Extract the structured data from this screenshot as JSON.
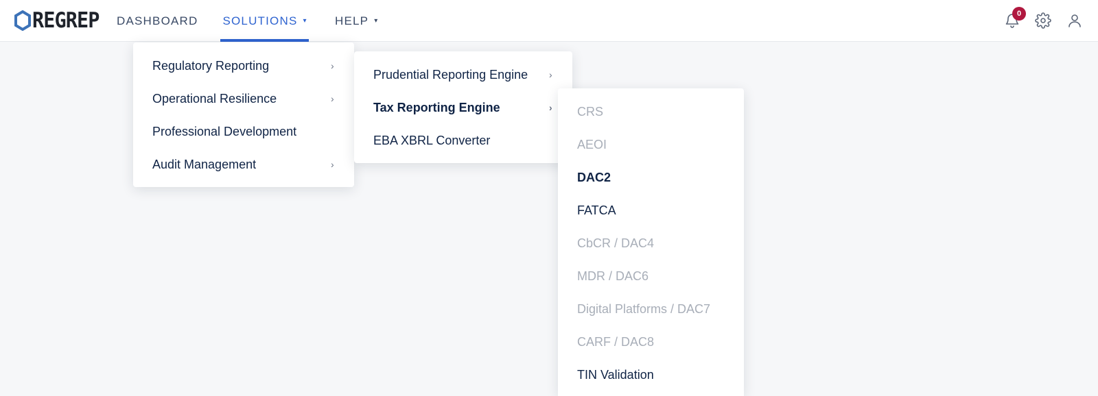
{
  "app": {
    "logo_text": "REGREP",
    "brand_color": "#3d73b8",
    "accent_color": "#2f64d0",
    "badge_color": "#b0183f"
  },
  "nav": {
    "dashboard": "DASHBOARD",
    "solutions": "SOLUTIONS",
    "help": "HELP",
    "caret": "▾"
  },
  "header_icons": {
    "notifications_icon": "bell-icon",
    "notifications_count": "0",
    "settings_icon": "gear-icon",
    "account_icon": "user-icon"
  },
  "solutions_menu": {
    "items": [
      {
        "label": "Regulatory Reporting",
        "has_submenu": true
      },
      {
        "label": "Operational Resilience",
        "has_submenu": true
      },
      {
        "label": "Professional Development",
        "has_submenu": false
      },
      {
        "label": "Audit Management",
        "has_submenu": true
      }
    ],
    "chevron": "›"
  },
  "regulatory_submenu": {
    "items": [
      {
        "label": "Prudential Reporting Engine",
        "has_submenu": true,
        "active": false
      },
      {
        "label": "Tax Reporting Engine",
        "has_submenu": true,
        "active": true
      },
      {
        "label": "EBA XBRL Converter",
        "has_submenu": false,
        "active": false
      }
    ]
  },
  "tax_submenu": {
    "items": [
      {
        "label": "CRS",
        "state": "disabled"
      },
      {
        "label": "AEOI",
        "state": "disabled"
      },
      {
        "label": "DAC2",
        "state": "active"
      },
      {
        "label": "FATCA",
        "state": "enabled"
      },
      {
        "label": "CbCR / DAC4",
        "state": "disabled"
      },
      {
        "label": "MDR / DAC6",
        "state": "disabled"
      },
      {
        "label": "Digital Platforms / DAC7",
        "state": "disabled"
      },
      {
        "label": "CARF / DAC8",
        "state": "disabled"
      },
      {
        "label": "TIN Validation",
        "state": "enabled"
      }
    ]
  }
}
